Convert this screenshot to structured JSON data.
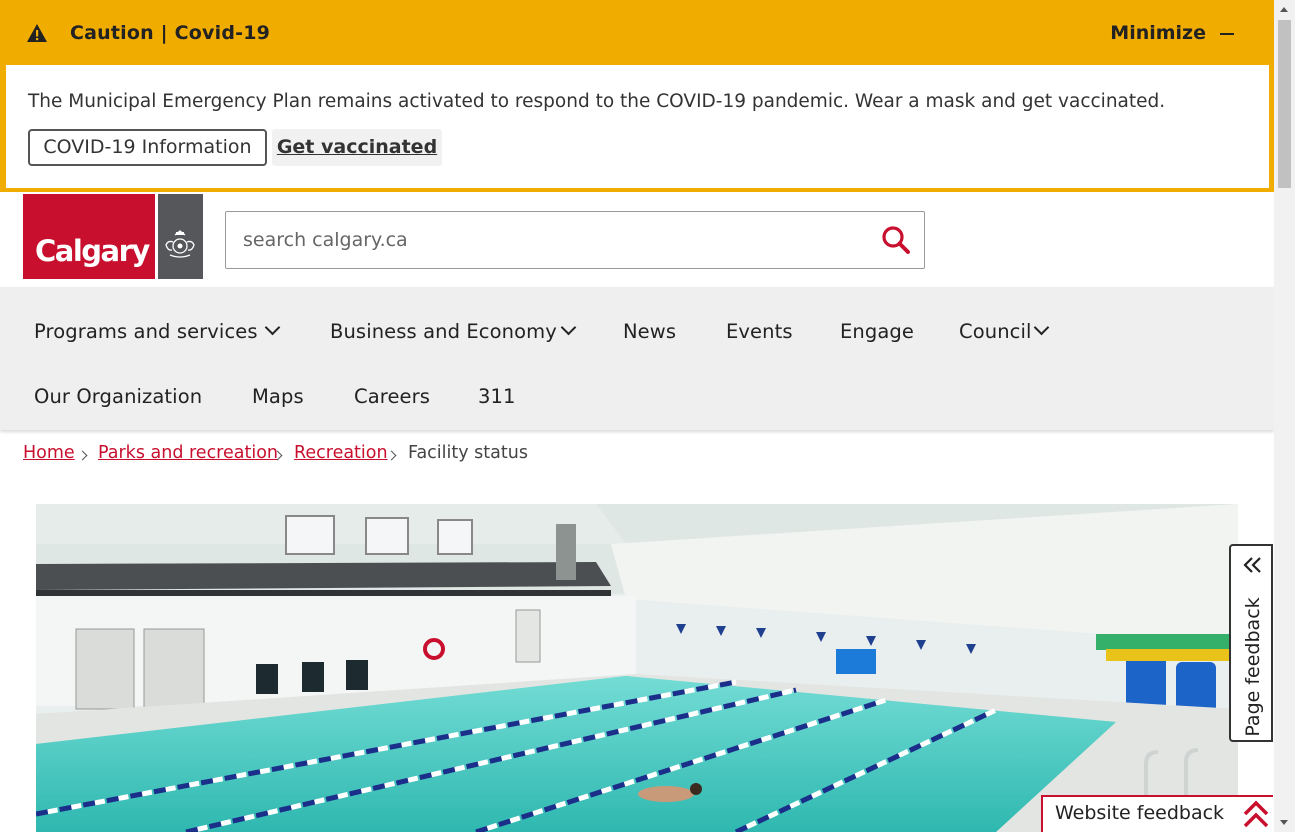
{
  "alert": {
    "title": "Caution | Covid-19",
    "minimize_label": "Minimize",
    "message": "The Municipal Emergency Plan remains activated to respond to the COVID-19 pandemic. Wear a mask and get vaccinated.",
    "primary_button": "COVID-19 Information",
    "secondary_button": "Get vaccinated",
    "color": "#f1ac00"
  },
  "header": {
    "logo_text": "Calgary",
    "brand_color": "#c8102e",
    "search": {
      "placeholder": "search calgary.ca",
      "value": ""
    }
  },
  "nav": {
    "items": [
      {
        "label": "Programs and services",
        "has_dropdown": true
      },
      {
        "label": "Business and Economy",
        "has_dropdown": true
      },
      {
        "label": "News",
        "has_dropdown": false
      },
      {
        "label": "Events",
        "has_dropdown": false
      },
      {
        "label": "Engage",
        "has_dropdown": false
      },
      {
        "label": "Council",
        "has_dropdown": true
      },
      {
        "label": "Our Organization",
        "has_dropdown": false
      },
      {
        "label": "Maps",
        "has_dropdown": false
      },
      {
        "label": "Careers",
        "has_dropdown": false
      },
      {
        "label": "311",
        "has_dropdown": false
      }
    ]
  },
  "breadcrumb": {
    "items": [
      "Home",
      "Parks and recreation",
      "Recreation"
    ],
    "current": "Facility status"
  },
  "hero": {
    "icon": "indoor-pool-photo"
  },
  "feedback": {
    "page_feedback_label": "Page feedback",
    "website_feedback_label": "Website feedback"
  }
}
